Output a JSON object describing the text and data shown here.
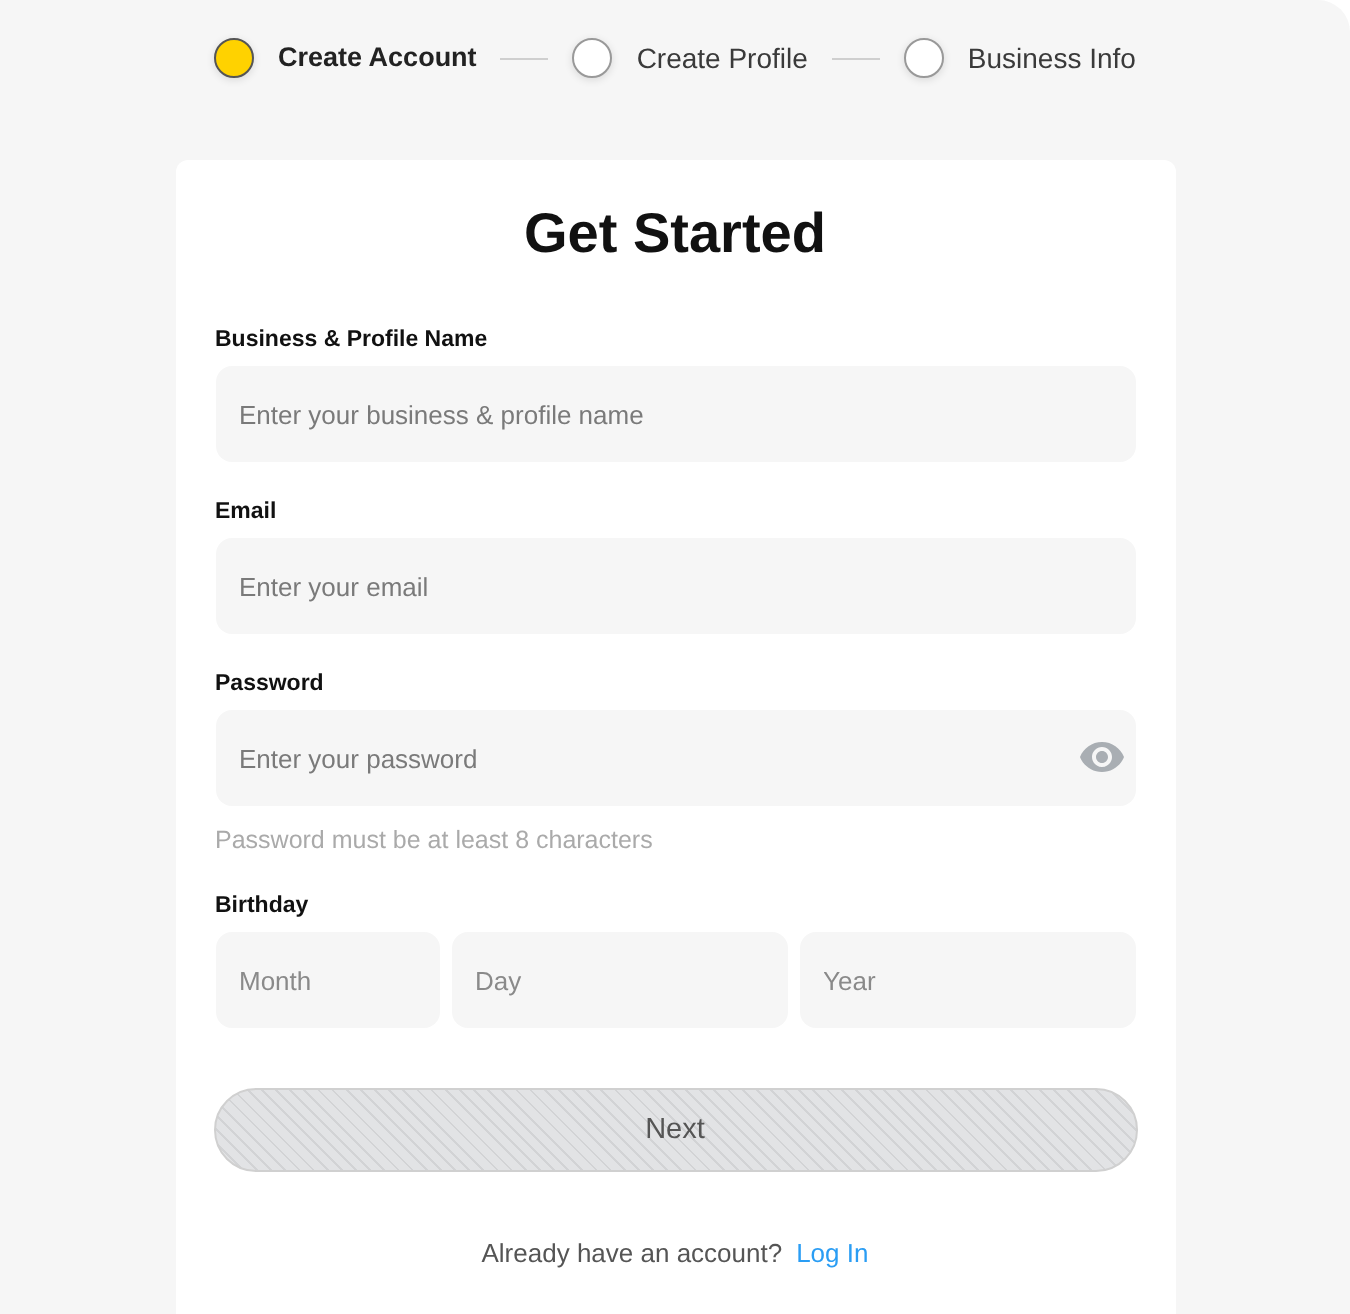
{
  "stepper": {
    "steps": [
      {
        "label": "Create Account",
        "active": true
      },
      {
        "label": "Create Profile",
        "active": false
      },
      {
        "label": "Business Info",
        "active": false
      }
    ]
  },
  "form": {
    "title": "Get Started",
    "fields": [
      {
        "kind": "text",
        "label": "Business & Profile Name",
        "placeholder": "Enter your business & profile name"
      },
      {
        "kind": "text",
        "label": "Email",
        "placeholder": "Enter your email"
      },
      {
        "kind": "password",
        "label": "Password",
        "placeholder": "Enter your password",
        "hint": "Password must be at least 8 characters"
      },
      {
        "kind": "date",
        "label": "Birthday",
        "parts": [
          {
            "placeholder": "Month"
          },
          {
            "placeholder": "Day"
          },
          {
            "placeholder": "Year"
          }
        ]
      }
    ],
    "next_button": {
      "label": "Next",
      "disabled": true
    },
    "footer": {
      "text": "Already have an account?",
      "link": "Log In"
    }
  }
}
